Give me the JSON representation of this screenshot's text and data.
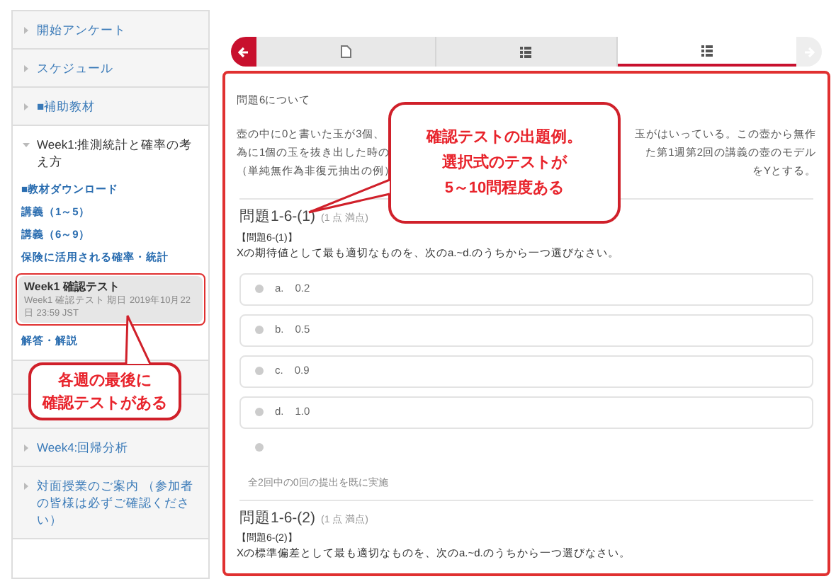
{
  "sidebar": {
    "items": [
      {
        "label": "開始アンケート",
        "expanded": false
      },
      {
        "label": "スケジュール",
        "expanded": false
      },
      {
        "label": "■補助教材",
        "expanded": false
      },
      {
        "label": "Week1:推測統計と確率の考え方",
        "expanded": true,
        "children": [
          {
            "kind": "link",
            "label": "■教材ダウンロード",
            "selected": false
          },
          {
            "kind": "link",
            "label": "講義（1～5）",
            "selected": false
          },
          {
            "kind": "link",
            "label": "講義（6～9）",
            "selected": false
          },
          {
            "kind": "link",
            "label": "保険に活用される確率・統計",
            "selected": false
          },
          {
            "kind": "test",
            "label": "Week1 確認テスト",
            "subtitle": "Week1 確認テスト 期日 2019年10月22日 23:59 JST",
            "selected": true
          },
          {
            "kind": "link",
            "label": "解答・解説",
            "selected": false
          }
        ]
      },
      {
        "label": "Week4:回帰分析",
        "expanded": false
      },
      {
        "label": "対面授業のご案内 （参加者の皆様は必ずご確認ください）",
        "expanded": false
      }
    ]
  },
  "tabs": [
    {
      "kind": "page",
      "selected": false
    },
    {
      "kind": "list",
      "selected": false
    },
    {
      "kind": "list",
      "selected": true
    }
  ],
  "content": {
    "intro": "問題6について",
    "paragraph_lines": [
      {
        "left": "壺の中に0と書いた玉が3個、",
        "right": "玉がはいっている。この壺から無作"
      },
      {
        "left": "為に1個の玉を抜き出した時の",
        "right": "た第1週第2回の講義の壺のモデル"
      },
      {
        "left": "（単純無作為非復元抽出の例）",
        "right": "をYとする。"
      }
    ],
    "questions": [
      {
        "title": "問題1-6-(1)",
        "points": "(1 点 満点)",
        "label": "【問題6-(1)】",
        "text": "Xの期待値として最も適切なものを、次のa.~d.のうちから一つ選びなさい。",
        "options": [
          {
            "letter": "a.",
            "value": "0.2",
            "selected": false
          },
          {
            "letter": "b.",
            "value": "0.5",
            "selected": false
          },
          {
            "letter": "c.",
            "value": "0.9",
            "selected": false
          },
          {
            "letter": "d.",
            "value": "1.0",
            "selected": false
          }
        ],
        "blank_choice": {
          "selected": false
        },
        "attempts": "全2回中の0回の提出を既に実施"
      },
      {
        "title": "問題1-6-(2)",
        "points": "(1 点 満点)",
        "label": "【問題6-(2)】",
        "text": "Xの標準偏差として最も適切なものを、次のa.~d.のうちから一つ選びなさい。"
      }
    ]
  },
  "callouts": [
    {
      "lines": [
        "確認テストの出題例。",
        "選択式のテストが",
        "5～10問程度ある"
      ]
    },
    {
      "lines": [
        "各週の最後に",
        "確認テストがある"
      ]
    }
  ]
}
